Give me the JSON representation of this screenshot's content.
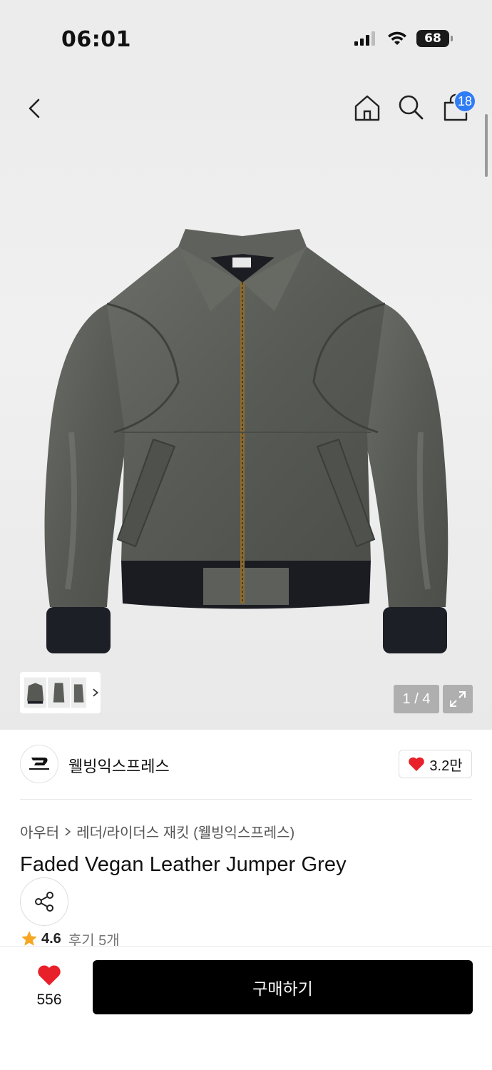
{
  "status_bar": {
    "time": "06:01",
    "battery": "68"
  },
  "header": {
    "back_icon": "chevron-left-icon",
    "home_icon": "home-icon",
    "search_icon": "search-icon",
    "bag_icon": "shopping-bag-icon",
    "bag_count": "18"
  },
  "gallery": {
    "page_counter": "1 / 4",
    "expand_icon": "expand-icon",
    "thumb_chevron_icon": "chevron-right-icon"
  },
  "brand": {
    "name": "웰빙익스프레스",
    "likes": "3.2만",
    "like_icon": "heart-icon"
  },
  "breadcrumb": {
    "level1": "아우터",
    "level2": "레더/라이더스 재킷 (웰빙익스프레스)"
  },
  "product": {
    "title": "Faded Vegan Leather Jumper Grey",
    "share_icon": "share-icon",
    "rating": "4.6",
    "reviews": "후기 5개"
  },
  "bottom_bar": {
    "wish_count": "556",
    "buy_label": "구매하기"
  },
  "colors": {
    "accent_blue": "#2f7cf6",
    "heart_red": "#e8202a",
    "star_orange": "#f5a623"
  }
}
